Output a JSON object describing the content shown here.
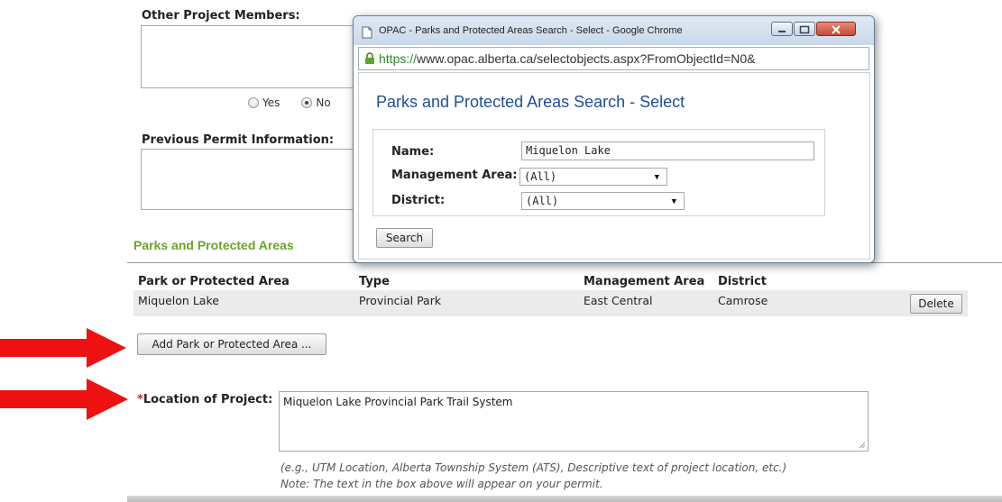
{
  "form": {
    "other_members_label": "Other Project Members:",
    "radio_yes_label": "Yes",
    "radio_no_label": "No",
    "radio_selected": "No",
    "previous_permit_label": "Previous Permit Information:",
    "parks_section_title": "Parks and Protected Areas",
    "table": {
      "headers": [
        "Park or Protected Area",
        "Type",
        "Management Area",
        "District"
      ],
      "rows": [
        {
          "park": "Miquelon Lake",
          "type": "Provincial Park",
          "management_area": "East Central",
          "district": "Camrose",
          "delete_label": "Delete"
        }
      ]
    },
    "add_park_button": "Add Park or Protected Area ...",
    "location_required_marker": "*",
    "location_label": "Location of Project:",
    "location_value": "Miquelon Lake Provincial Park Trail System",
    "location_hint_1": "(e.g., UTM Location, Alberta Township System (ATS), Descriptive text of project location, etc.)",
    "location_hint_2": "Note: The text in the box above will appear on your permit."
  },
  "popup": {
    "window_title": "OPAC - Parks and Protected Areas Search - Select - Google Chrome",
    "url_scheme": "https://",
    "url_rest": "www.opac.alberta.ca/selectobjects.aspx?FromObjectId=N0&",
    "heading": "Parks and Protected Areas Search - Select",
    "name_label": "Name:",
    "name_value": "Miquelon Lake",
    "management_label": "Management Area:",
    "management_value": "(All)",
    "district_label": "District:",
    "district_value": "(All)",
    "search_button": "Search"
  },
  "colors": {
    "section_green": "#6aa425",
    "arrow_red": "#ee1111",
    "popup_heading_blue": "#1f4e9c",
    "url_green": "#2a8a2a"
  },
  "icons": [
    "page-icon",
    "lock-icon",
    "minimize-icon",
    "maximize-icon",
    "close-icon",
    "resize-grip-icon",
    "arrow-right-icon"
  ]
}
